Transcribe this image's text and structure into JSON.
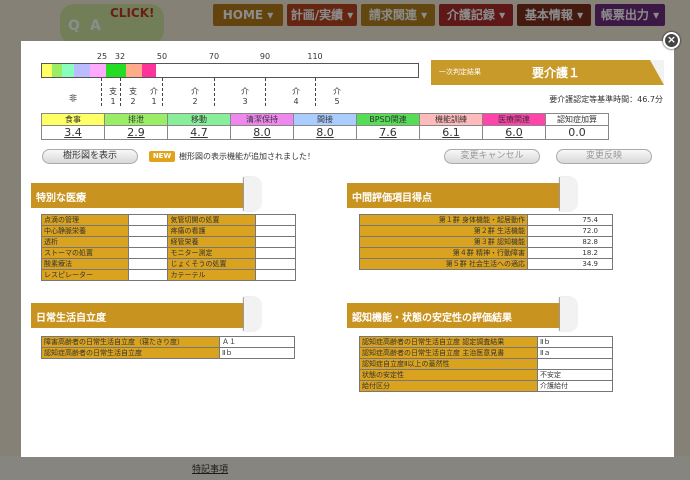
{
  "app": {
    "logo_text": "CLICK!",
    "nav": [
      {
        "label": "HOME",
        "color": "#b57c1c"
      },
      {
        "label": "計画/実績",
        "color": "#b8451f"
      },
      {
        "label": "請求関連",
        "color": "#b3841e"
      },
      {
        "label": "介護記録",
        "color": "#a92c2a"
      },
      {
        "label": "基本情報",
        "color": "#7d2f1e"
      },
      {
        "label": "帳票出力",
        "color": "#6e2c7e"
      }
    ],
    "bottom_link": "特記事項"
  },
  "modal": {
    "close_label": "×",
    "scale": {
      "ticks": [
        "25",
        "32",
        "50",
        "70",
        "90",
        "110"
      ],
      "levels": [
        {
          "l1": "非",
          "l2": ""
        },
        {
          "l1": "支",
          "l2": "1"
        },
        {
          "l1": "支",
          "l2": "2"
        },
        {
          "l1": "介",
          "l2": "1"
        },
        {
          "l1": "介",
          "l2": "2"
        },
        {
          "l1": "介",
          "l2": "3"
        },
        {
          "l1": "介",
          "l2": "4"
        },
        {
          "l1": "介",
          "l2": "5"
        }
      ],
      "bar_segment_colors": [
        "#ffff66",
        "#99ee66",
        "#88ffbb",
        "#bbbbff",
        "#ffaaff",
        "#22dd22",
        "#ffaa88",
        "#ff3399"
      ]
    },
    "result": {
      "label": "一次判定結果",
      "value": "要介護１",
      "time_text": "要介護認定等基準時間：46.7分"
    },
    "categories": [
      {
        "name": "食事",
        "value": "3.4",
        "color": "#ffff66"
      },
      {
        "name": "排泄",
        "value": "2.9",
        "color": "#99ee66"
      },
      {
        "name": "移動",
        "value": "4.7",
        "color": "#88ee99"
      },
      {
        "name": "清潔保持",
        "value": "8.0",
        "color": "#ee88ee"
      },
      {
        "name": "間接",
        "value": "8.0",
        "color": "#aaccff"
      },
      {
        "name": "BPSD関連",
        "value": "7.6",
        "color": "#55dd55"
      },
      {
        "name": "機能訓練",
        "value": "6.1",
        "color": "#ffbbbb"
      },
      {
        "name": "医療関連",
        "value": "6.0",
        "color": "#ff44aa"
      },
      {
        "name": "認知症加算",
        "value": "0.0",
        "color": "#ffffff"
      }
    ],
    "buttons": {
      "tree": "樹形図を表示",
      "new_badge": "NEW",
      "new_msg": "樹形図の表示機能が追加されました！",
      "cancel": "変更キャンセル",
      "apply": "変更反映"
    },
    "medical": {
      "title": "特別な医療",
      "rows": [
        [
          "点滴の管理",
          "",
          "気管切開の処置",
          ""
        ],
        [
          "中心静脈栄養",
          "",
          "疼痛の看護",
          ""
        ],
        [
          "透析",
          "",
          "経管栄養",
          ""
        ],
        [
          "ストーマの処置",
          "",
          "モニター測定",
          ""
        ],
        [
          "酸素療法",
          "",
          "じょくそうの処置",
          ""
        ],
        [
          "レスピレーター",
          "",
          "カテーテル",
          ""
        ]
      ]
    },
    "intermediate": {
      "title": "中間評価項目得点",
      "rows": [
        [
          "第１群 身体機能・起居動作",
          "75.4"
        ],
        [
          "第２群 生活機能",
          "72.0"
        ],
        [
          "第３群 認知機能",
          "82.8"
        ],
        [
          "第４群 精神・行動障害",
          "18.2"
        ],
        [
          "第５群 社会生活への適応",
          "34.9"
        ]
      ]
    },
    "daily": {
      "title": "日常生活自立度",
      "rows": [
        [
          "障害高齢者の日常生活自立度（寝たきり度）",
          "Ａ１"
        ],
        [
          "認知症高齢者の日常生活自立度",
          "Ⅱｂ"
        ]
      ]
    },
    "stability": {
      "title": "認知機能・状態の安定性の評価結果",
      "rows": [
        [
          "認知症高齢者の日常生活自立度 認定調査結果",
          "Ⅱｂ"
        ],
        [
          "認知症高齢者の日常生活自立度 主治医意見書",
          "Ⅱａ"
        ],
        [
          "認知症自立度Ⅱ以上の蓋然性",
          ""
        ],
        [
          "状態の安定性",
          "不安定"
        ],
        [
          "給付区分",
          "介護給付"
        ]
      ]
    }
  }
}
